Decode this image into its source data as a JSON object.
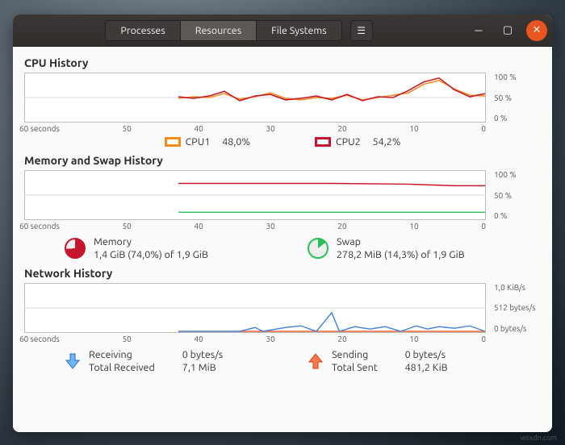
{
  "tabs": {
    "processes": "Processes",
    "resources": "Resources",
    "filesystems": "File Systems"
  },
  "sections": {
    "cpu": "CPU History",
    "memswap": "Memory and Swap History",
    "network": "Network History"
  },
  "xaxis": {
    "label": "60 seconds",
    "ticks": [
      "60 seconds",
      "50",
      "40",
      "30",
      "20",
      "10",
      "0"
    ]
  },
  "yaxis_pct": [
    "100 %",
    "50 %",
    "0 %"
  ],
  "yaxis_net": [
    "1,0 KiB/s",
    "512 bytes/s",
    "0 bytes/s"
  ],
  "cpu_legend": {
    "cpu1": {
      "label": "CPU1",
      "value": "48,0%",
      "color": "#f28c1a"
    },
    "cpu2": {
      "label": "CPU2",
      "value": "54,2%",
      "color": "#c7162b"
    }
  },
  "mem": {
    "memory": {
      "label": "Memory",
      "detail": "1,4 GiB (74,0%) of 1,9 GiB",
      "pct": 74,
      "color": "#c7162b"
    },
    "swap": {
      "label": "Swap",
      "detail": "278,2 MiB (14,3%) of 1,9 GiB",
      "pct": 14,
      "color": "#2bbf5b"
    }
  },
  "net": {
    "receiving": {
      "label": "Receiving",
      "rate": "0 bytes/s",
      "total_label": "Total Received",
      "total": "7,1 MiB",
      "color": "#3b7dd8"
    },
    "sending": {
      "label": "Sending",
      "rate": "0 bytes/s",
      "total_label": "Total Sent",
      "total": "481,2 KiB",
      "color": "#e95420"
    }
  },
  "watermark": "wsxdn.com",
  "chart_data": [
    {
      "type": "line",
      "title": "CPU History",
      "xlabel": "seconds",
      "ylabel": "%",
      "ylim": [
        0,
        100
      ],
      "xlim_seconds": [
        60,
        0
      ],
      "x": [
        40,
        38,
        36,
        34,
        32,
        30,
        28,
        26,
        24,
        22,
        20,
        18,
        16,
        14,
        12,
        10,
        8,
        6,
        4,
        2,
        0
      ],
      "series": [
        {
          "name": "CPU1",
          "color": "#f28c1a",
          "values": [
            48,
            52,
            50,
            58,
            46,
            50,
            60,
            48,
            45,
            50,
            48,
            54,
            46,
            50,
            54,
            60,
            78,
            86,
            68,
            56,
            54
          ]
        },
        {
          "name": "CPU2",
          "color": "#c7162b",
          "values": [
            50,
            48,
            52,
            62,
            44,
            52,
            56,
            46,
            48,
            52,
            46,
            56,
            44,
            52,
            50,
            64,
            82,
            90,
            66,
            52,
            58
          ]
        }
      ]
    },
    {
      "type": "line",
      "title": "Memory and Swap History",
      "xlabel": "seconds",
      "ylabel": "%",
      "ylim": [
        0,
        100
      ],
      "xlim_seconds": [
        60,
        0
      ],
      "x": [
        40,
        35,
        30,
        25,
        20,
        15,
        10,
        5,
        0
      ],
      "series": [
        {
          "name": "Memory",
          "color": "#c7162b",
          "values": [
            74,
            74,
            74,
            74,
            74,
            74,
            73,
            71,
            70
          ]
        },
        {
          "name": "Swap",
          "color": "#2bbf5b",
          "values": [
            14,
            14,
            14,
            14,
            14,
            14,
            14,
            14,
            14
          ]
        }
      ]
    },
    {
      "type": "line",
      "title": "Network History",
      "xlabel": "seconds",
      "ylabel": "bytes/s",
      "ylim": [
        0,
        1024
      ],
      "xlim_seconds": [
        60,
        0
      ],
      "x": [
        40,
        36,
        32,
        30,
        28,
        26,
        24,
        22,
        21,
        20,
        18,
        16,
        14,
        12,
        10,
        8,
        6,
        4,
        2,
        0
      ],
      "series": [
        {
          "name": "Receiving",
          "color": "#3b7dd8",
          "values": [
            0,
            0,
            0,
            80,
            0,
            80,
            120,
            0,
            400,
            0,
            100,
            60,
            100,
            0,
            120,
            60,
            100,
            80,
            120,
            0
          ]
        },
        {
          "name": "Sending",
          "color": "#e95420",
          "values": [
            0,
            0,
            0,
            0,
            0,
            0,
            0,
            0,
            0,
            0,
            0,
            0,
            0,
            0,
            0,
            0,
            0,
            0,
            0,
            0
          ]
        }
      ]
    }
  ]
}
